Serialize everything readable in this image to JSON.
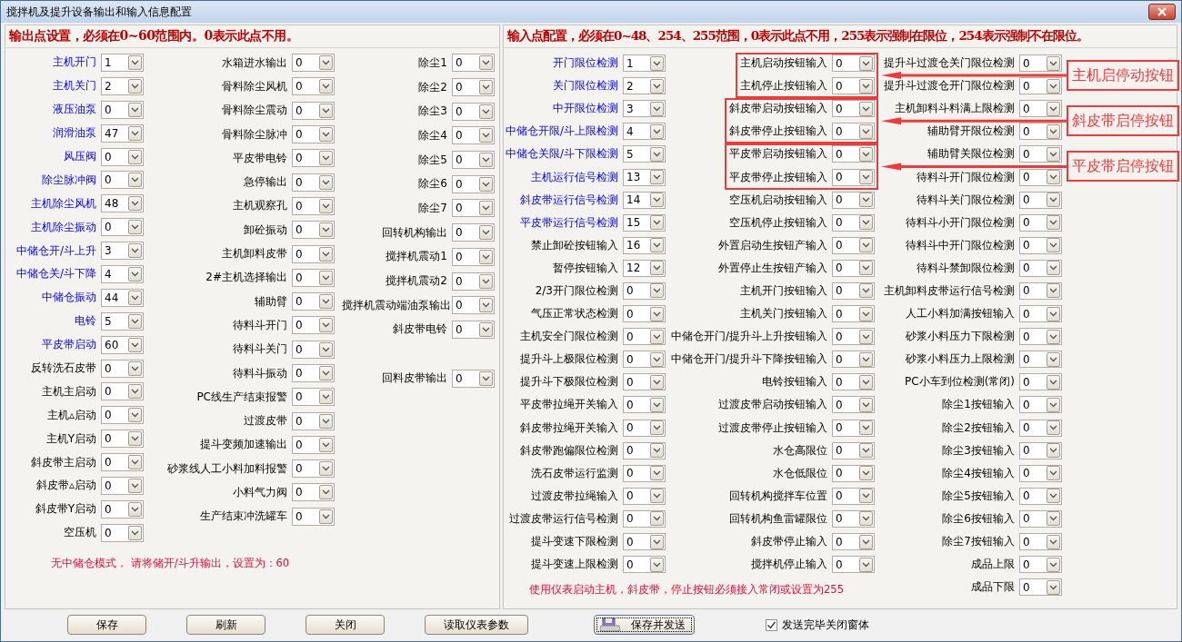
{
  "window": {
    "title": "搅拌机及提升设备输出和输入信息配置"
  },
  "output_panel": {
    "header": "输出点设置，必须在0~60范围内。0表示此点不用。",
    "columns": [
      [
        {
          "label": "主机开门",
          "value": "1",
          "highlighted": true
        },
        {
          "label": "主机关门",
          "value": "2",
          "highlighted": true
        },
        {
          "label": "液压油泵",
          "value": "0",
          "highlighted": true
        },
        {
          "label": "润滑油泵",
          "value": "47",
          "highlighted": true
        },
        {
          "label": "风压阀",
          "value": "0",
          "highlighted": true
        },
        {
          "label": "除尘脉冲阀",
          "value": "0",
          "highlighted": true
        },
        {
          "label": "主机除尘风机",
          "value": "48",
          "highlighted": true
        },
        {
          "label": "主机除尘振动",
          "value": "0",
          "highlighted": true
        },
        {
          "label": "中储仓开/斗上升",
          "value": "3",
          "highlighted": true
        },
        {
          "label": "中储仓关/斗下降",
          "value": "4",
          "highlighted": true
        },
        {
          "label": "中储仓振动",
          "value": "44",
          "highlighted": true
        },
        {
          "label": "电铃",
          "value": "5",
          "highlighted": true
        },
        {
          "label": "平皮带启动",
          "value": "60",
          "highlighted": true
        },
        {
          "label": "反转洗石皮带",
          "value": "0",
          "highlighted": false
        },
        {
          "label": "主机主启动",
          "value": "0",
          "highlighted": false
        },
        {
          "label": "主机▵启动",
          "value": "0",
          "highlighted": false
        },
        {
          "label": "主机Y启动",
          "value": "0",
          "highlighted": false
        },
        {
          "label": "斜皮带主启动",
          "value": "0",
          "highlighted": false
        },
        {
          "label": "斜皮带▵启动",
          "value": "0",
          "highlighted": false
        },
        {
          "label": "斜皮带Y启动",
          "value": "0",
          "highlighted": false
        },
        {
          "label": "空压机",
          "value": "0",
          "highlighted": false
        }
      ],
      [
        {
          "label": "水箱进水输出",
          "value": "0"
        },
        {
          "label": "骨料除尘风机",
          "value": "0"
        },
        {
          "label": "骨料除尘震动",
          "value": "0"
        },
        {
          "label": "骨料除尘脉冲",
          "value": "0"
        },
        {
          "label": "平皮带电铃",
          "value": "0"
        },
        {
          "label": "急停输出",
          "value": "0"
        },
        {
          "label": "主机观察孔",
          "value": "0"
        },
        {
          "label": "卸砼振动",
          "value": "0"
        },
        {
          "label": "主机卸料皮带",
          "value": "0"
        },
        {
          "label": "2#主机选择输出",
          "value": "0"
        },
        {
          "label": "辅助臂",
          "value": "0"
        },
        {
          "label": "待料斗开门",
          "value": "0"
        },
        {
          "label": "待料斗关门",
          "value": "0"
        },
        {
          "label": "待料斗振动",
          "value": "0"
        },
        {
          "label": "PC线生产结束报警",
          "value": "0"
        },
        {
          "label": "过渡皮带",
          "value": "0"
        },
        {
          "label": "提斗变频加速输出",
          "value": "0"
        },
        {
          "label": "砂浆线人工小料加料报警",
          "value": "0"
        },
        {
          "label": "小料气力阀",
          "value": "0"
        },
        {
          "label": "生产结束冲洗罐车",
          "value": "0"
        }
      ],
      [
        {
          "label": "除尘1",
          "value": "0"
        },
        {
          "label": "除尘2",
          "value": "0"
        },
        {
          "label": "除尘3",
          "value": "0"
        },
        {
          "label": "除尘4",
          "value": "0"
        },
        {
          "label": "除尘5",
          "value": "0"
        },
        {
          "label": "除尘6",
          "value": "0"
        },
        {
          "label": "除尘7",
          "value": "0"
        },
        {
          "label": "回转机构输出",
          "value": "0"
        },
        {
          "label": "搅拌机震动1",
          "value": "0"
        },
        {
          "label": "搅拌机震动2",
          "value": "0"
        },
        {
          "label": "搅拌机震动端油泵输出",
          "value": "0"
        },
        {
          "label": "斜皮带电铃",
          "value": "0"
        },
        {
          "label": "回料皮带输出",
          "value": "0"
        }
      ]
    ],
    "note": "无中储仓模式， 请将储开/斗升输出，设置为：60"
  },
  "input_panel": {
    "header": "输入点配置，必须在0~48、254、255范围，0表示此点不用，255表示强制在限位，254表示强制不在限位。",
    "columns": [
      [
        {
          "label": "开门限位检测",
          "value": "1",
          "highlighted": true
        },
        {
          "label": "关门限位检测",
          "value": "2",
          "highlighted": true
        },
        {
          "label": "中开限位检测",
          "value": "3",
          "highlighted": true
        },
        {
          "label": "中储仓开限/斗上限检测",
          "value": "4",
          "highlighted": true
        },
        {
          "label": "中储仓关限/斗下限检测",
          "value": "5",
          "highlighted": true
        },
        {
          "label": "主机运行信号检测",
          "value": "13",
          "highlighted": true
        },
        {
          "label": "斜皮带运行信号检测",
          "value": "14",
          "highlighted": true
        },
        {
          "label": "平皮带运行信号检测",
          "value": "15",
          "highlighted": true
        },
        {
          "label": "禁止卸砼按钮输入",
          "value": "16",
          "highlighted": false
        },
        {
          "label": "暂停按钮输入",
          "value": "12",
          "highlighted": false
        },
        {
          "label": "2/3开门限位检测",
          "value": "0",
          "highlighted": false
        },
        {
          "label": "气压正常状态检测",
          "value": "0",
          "highlighted": false
        },
        {
          "label": "主机安全门限位检测",
          "value": "0",
          "highlighted": false
        },
        {
          "label": "提升斗上极限位检测",
          "value": "0",
          "highlighted": false
        },
        {
          "label": "提升斗下极限位检测",
          "value": "0",
          "highlighted": false
        },
        {
          "label": "平皮带拉绳开关输入",
          "value": "0",
          "highlighted": false
        },
        {
          "label": "斜皮带拉绳开关输入",
          "value": "0",
          "highlighted": false
        },
        {
          "label": "斜皮带跑偏限位检测",
          "value": "0",
          "highlighted": false
        },
        {
          "label": "洗石皮带运行监测",
          "value": "0",
          "highlighted": false
        },
        {
          "label": "过渡皮带拉绳输入",
          "value": "0",
          "highlighted": false
        },
        {
          "label": "过渡皮带运行信号检测",
          "value": "0",
          "highlighted": false
        },
        {
          "label": "提斗变速下限检测",
          "value": "0",
          "highlighted": false
        },
        {
          "label": "提斗变速上限检测",
          "value": "0",
          "highlighted": false
        }
      ],
      [
        {
          "label": "主机启动按钮输入",
          "value": "0"
        },
        {
          "label": "主机停止按钮输入",
          "value": "0"
        },
        {
          "label": "斜皮带启动按钮输入",
          "value": "0"
        },
        {
          "label": "斜皮带停止按钮输入",
          "value": "0"
        },
        {
          "label": "平皮带启动按钮输入",
          "value": "0"
        },
        {
          "label": "平皮带停止按钮输入",
          "value": "0"
        },
        {
          "label": "空压机启动按钮输入",
          "value": "0"
        },
        {
          "label": "空压机停止按钮输入",
          "value": "0"
        },
        {
          "label": "外置启动生按钮产输入",
          "value": "0"
        },
        {
          "label": "外置停止生按钮产输入",
          "value": "0"
        },
        {
          "label": "主机开门按钮输入",
          "value": "0"
        },
        {
          "label": "主机关门按钮输入",
          "value": "0"
        },
        {
          "label": "中储仓开门/提升斗上升按钮输入",
          "value": "0"
        },
        {
          "label": "中储仓开门/提升斗下降按钮输入",
          "value": "0"
        },
        {
          "label": "电铃按钮输入",
          "value": "0"
        },
        {
          "label": "过渡皮带启动按钮输入",
          "value": "0"
        },
        {
          "label": "过渡皮带停止按钮输入",
          "value": "0"
        },
        {
          "label": "水仓高限位",
          "value": "0"
        },
        {
          "label": "水仓低限位",
          "value": "0"
        },
        {
          "label": "回转机构搅拌车位置",
          "value": "0"
        },
        {
          "label": "回转机构鱼雷罐限位",
          "value": "0"
        },
        {
          "label": "斜皮带停止输入",
          "value": "0"
        },
        {
          "label": "搅拌机停止输入",
          "value": "0"
        }
      ],
      [
        {
          "label": "提升斗过渡仓关门限位检测",
          "value": "0"
        },
        {
          "label": "提升斗过渡仓开门限位检测",
          "value": "0"
        },
        {
          "label": "主机卸料斗料满上限检测",
          "value": "0"
        },
        {
          "label": "辅助臂开限位检测",
          "value": "0"
        },
        {
          "label": "辅助臂关限位检测",
          "value": "0"
        },
        {
          "label": "待料斗开门限位检测",
          "value": "0"
        },
        {
          "label": "待料斗关门限位检测",
          "value": "0"
        },
        {
          "label": "待料斗小开门限位检测",
          "value": "0"
        },
        {
          "label": "待料斗中开门限位检测",
          "value": "0"
        },
        {
          "label": "待料斗禁卸限位检测",
          "value": "0"
        },
        {
          "label": "主机卸料皮带运行信号检测",
          "value": "0"
        },
        {
          "label": "人工小料加满按钮输入",
          "value": "0"
        },
        {
          "label": "砂浆小料压力下限检测",
          "value": "0"
        },
        {
          "label": "砂浆小料压力上限检测",
          "value": "0"
        },
        {
          "label": "PC小车到位检测(常闭)",
          "value": "0"
        },
        {
          "label": "除尘1按钮输入",
          "value": "0"
        },
        {
          "label": "除尘2按钮输入",
          "value": "0"
        },
        {
          "label": "除尘3按钮输入",
          "value": "0"
        },
        {
          "label": "除尘4按钮输入",
          "value": "0"
        },
        {
          "label": "除尘5按钮输入",
          "value": "0"
        },
        {
          "label": "除尘6按钮输入",
          "value": "0"
        },
        {
          "label": "除尘7按钮输入",
          "value": "0"
        },
        {
          "label": "成品上限",
          "value": "0"
        },
        {
          "label": "成品下限",
          "value": "0"
        }
      ]
    ],
    "note": "使用仪表启动主机，斜皮带，停止按钮必须接入常闭或设置为255"
  },
  "annotations": [
    {
      "label": "主机启停动按钮"
    },
    {
      "label": "斜皮带启停按钮"
    },
    {
      "label": "平皮带启停按钮"
    }
  ],
  "buttons": [
    {
      "label": "保存",
      "kind": "plain"
    },
    {
      "label": "刷新",
      "kind": "plain"
    },
    {
      "label": "关闭",
      "kind": "plain"
    },
    {
      "label": "读取仪表参数",
      "kind": "plain"
    },
    {
      "label": "保存并发送",
      "kind": "send"
    }
  ],
  "close_after_send": {
    "label": "发送完毕关闭窗体",
    "checked": true
  }
}
